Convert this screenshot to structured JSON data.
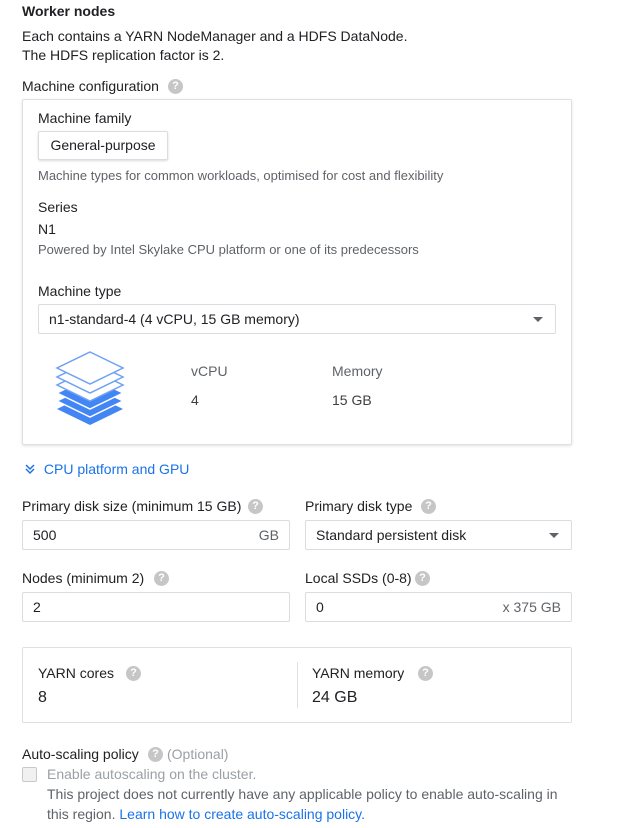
{
  "section": {
    "title": "Worker nodes",
    "desc_line1": "Each contains a YARN NodeManager and a HDFS DataNode.",
    "desc_line2": "The HDFS replication factor is 2."
  },
  "machine_config": {
    "label": "Machine configuration",
    "help_icon": "help-circle-icon",
    "family_label": "Machine family",
    "family_chip": "General-purpose",
    "family_desc": "Machine types for common workloads, optimised for cost and flexibility",
    "series_label": "Series",
    "series_value": "N1",
    "series_desc": "Powered by Intel Skylake CPU platform or one of its predecessors",
    "type_label": "Machine type",
    "type_value": "n1-standard-4 (4 vCPU, 15 GB memory)",
    "stack_icon": "layers-stack-icon",
    "vcpu_label": "vCPU",
    "vcpu_value": "4",
    "memory_label": "Memory",
    "memory_value": "15 GB"
  },
  "cpu_gpu": {
    "label": "CPU platform and GPU",
    "icon": "chevron-double-down-icon"
  },
  "disk": {
    "size_label": "Primary disk size (minimum 15 GB)",
    "size_value": "500",
    "size_suffix": "GB",
    "type_label": "Primary disk type",
    "type_value": "Standard persistent disk"
  },
  "nodes": {
    "label": "Nodes (minimum 2)",
    "value": "2"
  },
  "ssd": {
    "label": "Local SSDs (0-8)",
    "value": "0",
    "suffix": "x 375 GB"
  },
  "yarn": {
    "cores_label": "YARN cores",
    "cores_value": "8",
    "memory_label": "YARN memory",
    "memory_value": "24 GB"
  },
  "autoscale": {
    "label": "Auto-scaling policy",
    "optional": "(Optional)",
    "checkbox_label": "Enable autoscaling on the cluster.",
    "note_line1": "This project does not currently have any applicable policy to enable auto-scaling in",
    "note_line2_prefix": "this region. ",
    "link_text": "Learn how to create auto-scaling policy."
  },
  "colors": {
    "accent": "#1a73e8",
    "icon_blue": "#4285f4",
    "help_grey": "#c6c6c6"
  }
}
